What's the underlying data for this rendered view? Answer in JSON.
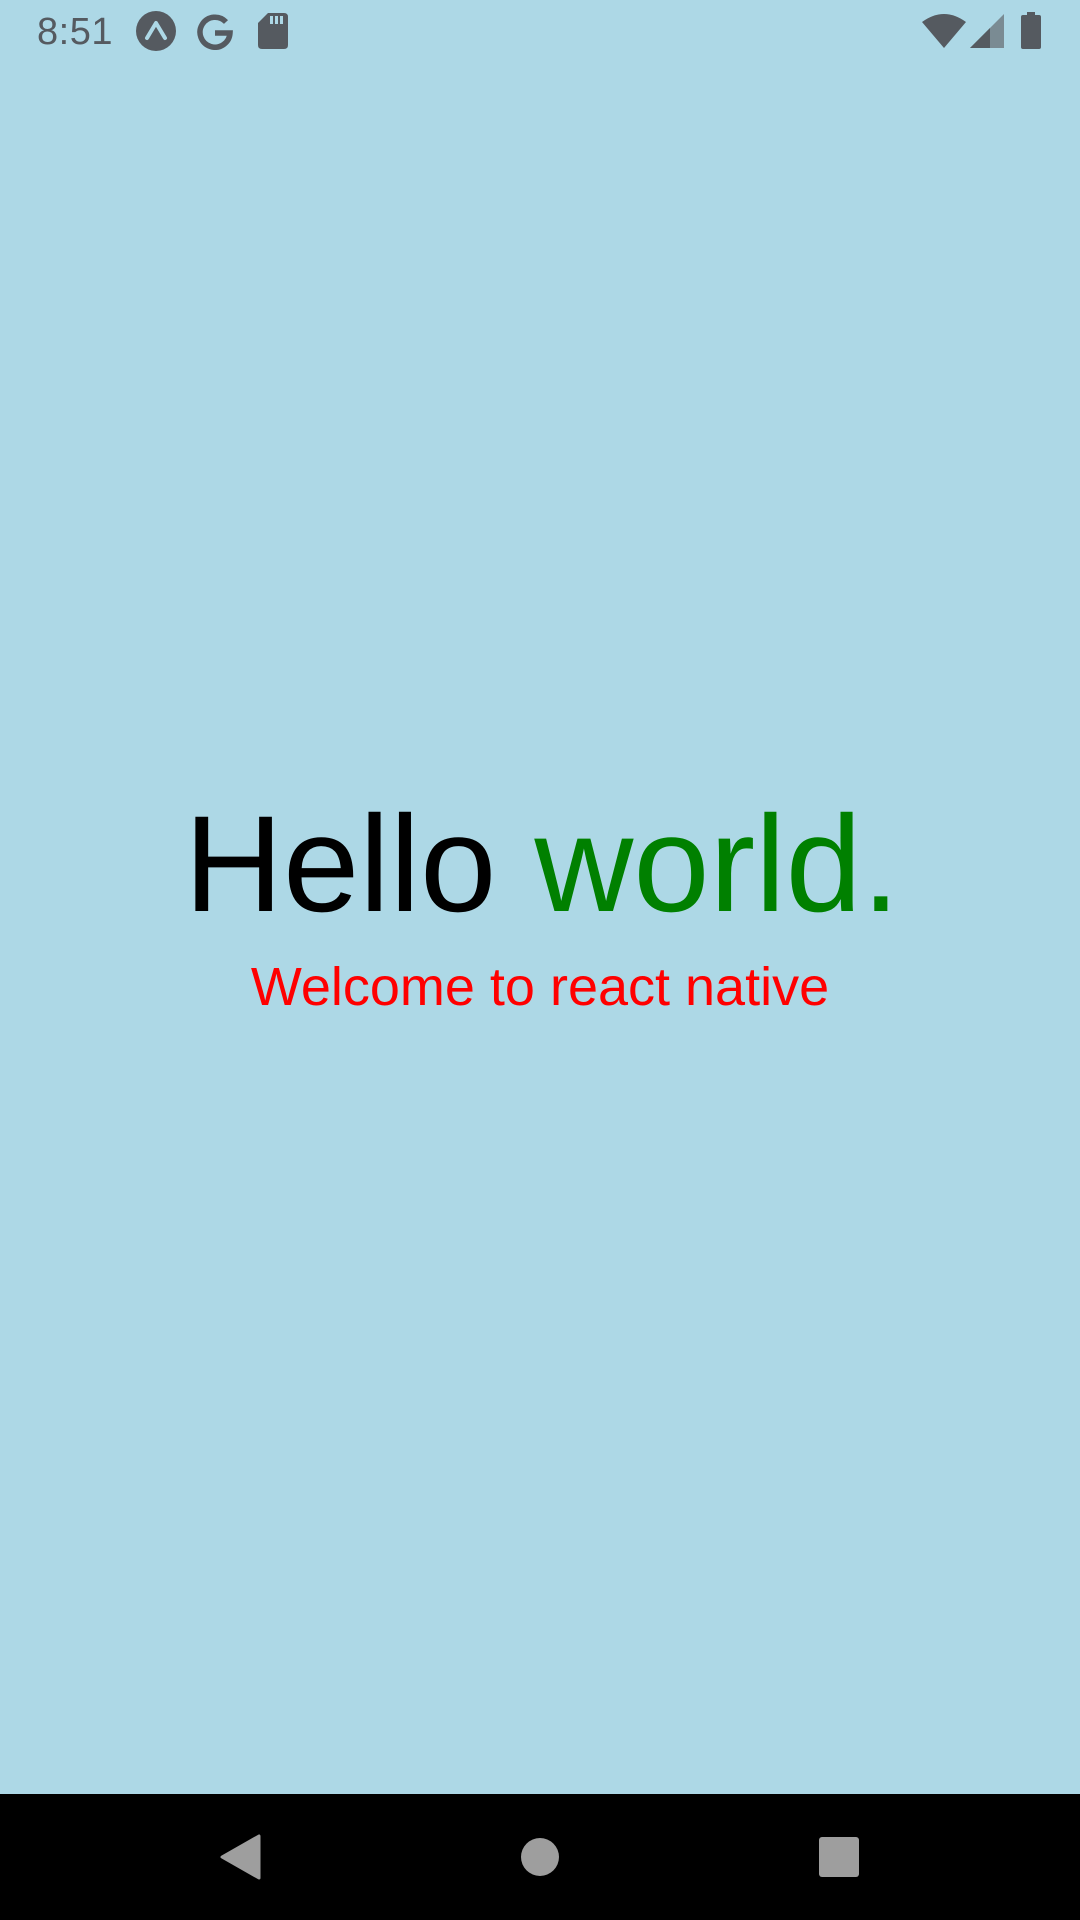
{
  "status_bar": {
    "time": "8:51",
    "left_icons": [
      "expo-icon",
      "google-icon",
      "sd-card-icon"
    ],
    "right_icons": [
      "wifi-icon",
      "cell-signal-icon",
      "battery-icon"
    ],
    "icon_color": "#555a60"
  },
  "app": {
    "background_color": "#add8e6",
    "headline_part1": "Hello ",
    "headline_part2": "world.",
    "headline_part1_color": "#000000",
    "headline_part2_color": "#008000",
    "subtitle": "Welcome to react native",
    "subtitle_color": "#ff0000"
  },
  "nav_bar": {
    "buttons": [
      "back",
      "home",
      "recents"
    ],
    "button_color": "#9e9e9e"
  }
}
